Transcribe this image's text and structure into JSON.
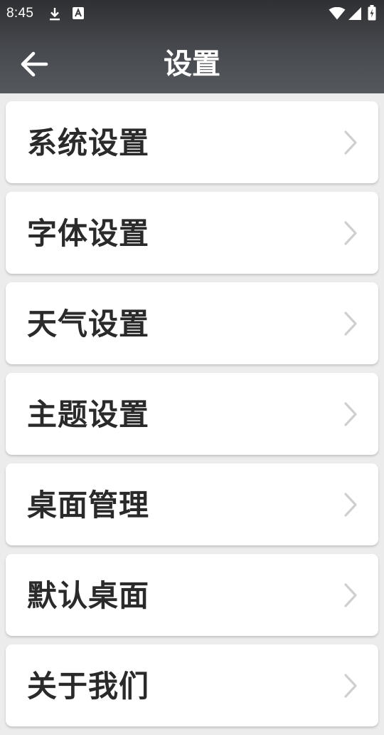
{
  "status_bar": {
    "time": "8:45",
    "icons": [
      "download-icon",
      "a-badge-icon",
      "wifi-icon",
      "signal-icon",
      "battery-charging-icon"
    ]
  },
  "app_bar": {
    "title": "设置",
    "back_icon": "arrow-left-icon"
  },
  "menu": {
    "items": [
      {
        "label": "系统设置"
      },
      {
        "label": "字体设置"
      },
      {
        "label": "天气设置"
      },
      {
        "label": "主题设置"
      },
      {
        "label": "桌面管理"
      },
      {
        "label": "默认桌面"
      },
      {
        "label": "关于我们"
      }
    ],
    "chevron_icon": "chevron-right-icon"
  },
  "colors": {
    "header_gradient_top": "#2f3033",
    "header_gradient_bottom": "#55595e",
    "background": "#ececec",
    "card": "#ffffff",
    "label_text": "#2a2a2a",
    "chevron": "#cfcfcf"
  }
}
